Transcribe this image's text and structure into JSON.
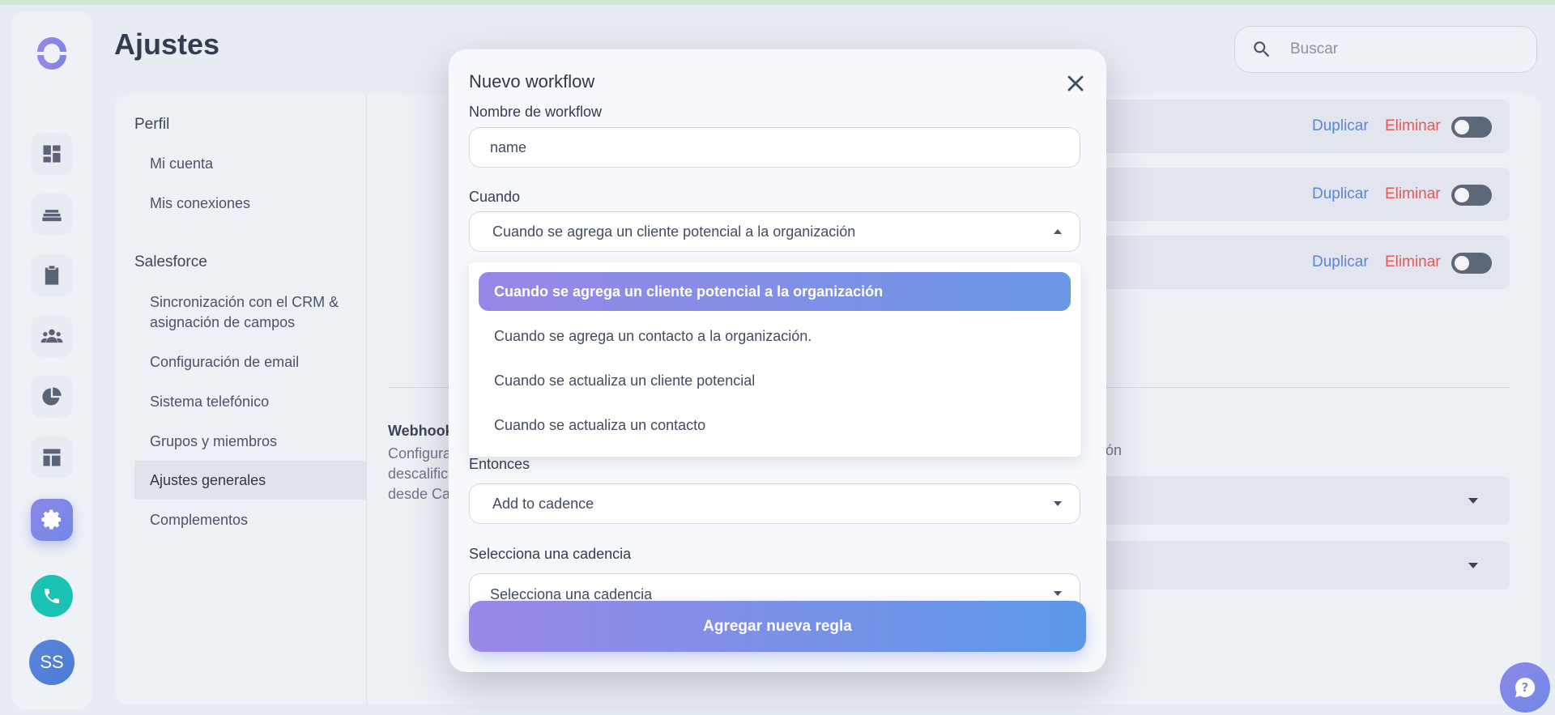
{
  "page": {
    "title": "Ajustes"
  },
  "search": {
    "placeholder": "Buscar"
  },
  "user": {
    "initials": "SS"
  },
  "settings_nav": {
    "profile_heading": "Perfil",
    "profile_items": [
      "Mi cuenta",
      "Mis conexiones"
    ],
    "salesforce_heading": "Salesforce",
    "salesforce_items": [
      "Sincronización con el CRM & asignación de campos",
      "Configuración de email",
      "Sistema telefónico",
      "Grupos y miembros",
      "Ajustes generales",
      "Complementos"
    ],
    "active": "Ajustes generales"
  },
  "rules": {
    "duplicate_label": "Duplicar",
    "delete_label": "Eliminar"
  },
  "webhook": {
    "title": "Webhook",
    "desc_lines": [
      "Configura",
      "descalific",
      "desde Ca"
    ],
    "tail": "ón"
  },
  "modal": {
    "title": "Nuevo workflow",
    "name_label": "Nombre de workflow",
    "name_value": "name",
    "when_label": "Cuando",
    "when_value": "Cuando se agrega un cliente potencial a la organización",
    "when_options": [
      "Cuando se agrega un cliente potencial a la organización",
      "Cuando se agrega un contacto a la organización.",
      "Cuando se actualiza un cliente potencial",
      "Cuando se actualiza un contacto"
    ],
    "then_label": "Entonces",
    "then_value": "Add to cadence",
    "cadence_label": "Selecciona una cadencia",
    "cadence_value": "Selecciona una cadencia",
    "add_button": "Agregar nueva regla"
  },
  "colors": {
    "accent_start": "#9b88e8",
    "accent_end": "#5c98e8",
    "duplicate": "#5a86d6",
    "delete": "#e25a5a",
    "phone": "#19c2b2"
  }
}
